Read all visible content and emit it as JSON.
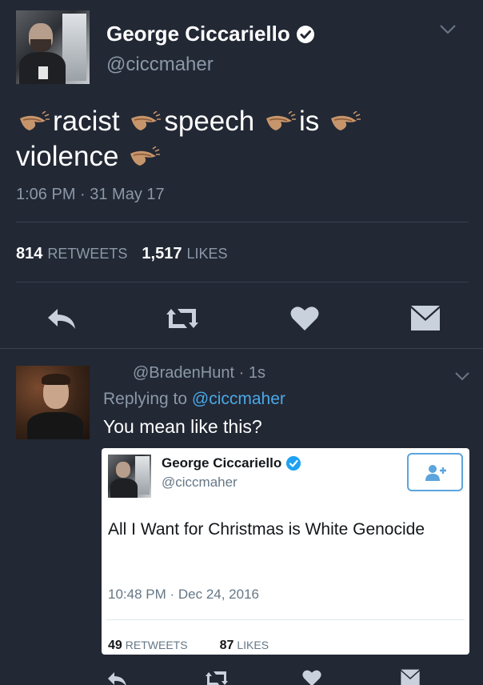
{
  "main_tweet": {
    "display_name": "George Ciccariello",
    "handle": "@ciccmaher",
    "text_words": [
      "racist",
      "speech",
      "is",
      "violence"
    ],
    "timestamp": "1:06 PM · 31 May 17",
    "retweets_count": "814",
    "retweets_label": "RETWEETS",
    "likes_count": "1,517",
    "likes_label": "LIKES"
  },
  "reply": {
    "handle_time": "@BradenHunt · 1s",
    "replying_prefix": "Replying to",
    "replying_handle": "@ciccmaher",
    "text": "You mean like this?"
  },
  "embedded_card": {
    "display_name": "George Ciccariello",
    "handle": "@ciccmaher",
    "text": "All I Want for Christmas is White Genocide",
    "timestamp": "10:48 PM · Dec 24, 2016",
    "retweets_count": "49",
    "retweets_label": "RETWEETS",
    "likes_count": "87",
    "likes_label": "LIKES"
  },
  "colors": {
    "background": "#222834",
    "secondary_text": "#8b98a8",
    "link": "#4aa8e8",
    "verified": "#1da1f2",
    "clap_emoji": "#c7956b"
  },
  "icons": [
    "verified-badge-icon",
    "chevron-down-icon",
    "clapping-hands-emoji",
    "reply-icon",
    "retweet-icon",
    "heart-icon",
    "direct-message-icon",
    "follow-icon"
  ]
}
